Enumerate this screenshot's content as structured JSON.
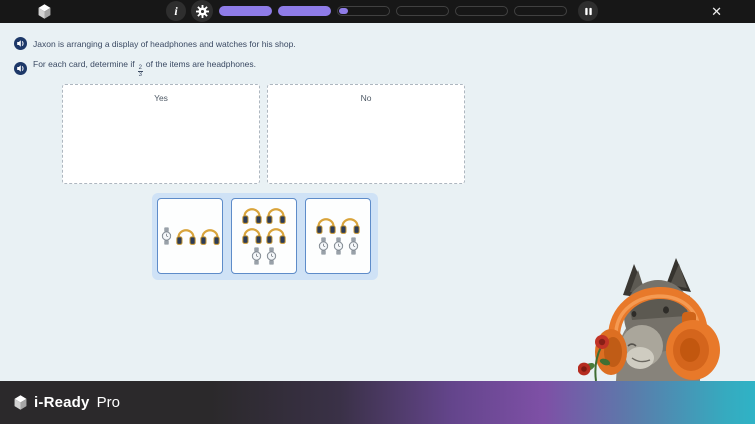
{
  "top_bar": {
    "info_label": "i",
    "close_label": "✕",
    "progress": {
      "segments": [
        {
          "state": "filled"
        },
        {
          "state": "filled"
        },
        {
          "state": "started",
          "fill_pct": 18
        },
        {
          "state": "empty"
        },
        {
          "state": "empty"
        },
        {
          "state": "empty"
        }
      ]
    }
  },
  "instructions": {
    "line1": {
      "text": "Jaxon is arranging a display of headphones and watches for his shop."
    },
    "line2": {
      "text_before": "For each card, determine if",
      "fraction": {
        "numerator": "2",
        "denominator": "3"
      },
      "text_after": "of the items are headphones."
    }
  },
  "drop_zones": [
    {
      "label": "Yes"
    },
    {
      "label": "No"
    }
  ],
  "cards": [
    {
      "rows": [
        [
          "watch",
          "headphone",
          "headphone"
        ]
      ]
    },
    {
      "rows": [
        [
          "headphone",
          "headphone"
        ],
        [
          "headphone",
          "headphone"
        ],
        [
          "watch",
          "watch"
        ]
      ]
    },
    {
      "rows": [
        [
          "headphone",
          "headphone"
        ],
        [
          "watch",
          "watch",
          "watch"
        ]
      ]
    }
  ],
  "footer": {
    "brand": "i-Ready",
    "brand_suffix": "Pro"
  },
  "colors": {
    "topbar_bg": "#171717",
    "progress_fill": "#8f7ce8",
    "main_bg": "#e9f1f4",
    "tray_bg": "#cfe2f6",
    "card_border": "#5e8cc9",
    "instruction_text": "#3b4a63",
    "audio_icon_navy": "#1d3868",
    "headphone_orange": "#e8792a",
    "footer_purple": "#7e50a6",
    "footer_teal": "#2fb3c6"
  },
  "icons": {
    "logo": "cube-icon",
    "top_buttons": [
      "info-icon",
      "gear-icon",
      "pause-icon",
      "close-icon"
    ],
    "instruction_audio": "speaker-audio-icon",
    "card_items": [
      "watch-icon",
      "headphone-icon"
    ],
    "mascot": "llama-with-headphones-image"
  }
}
